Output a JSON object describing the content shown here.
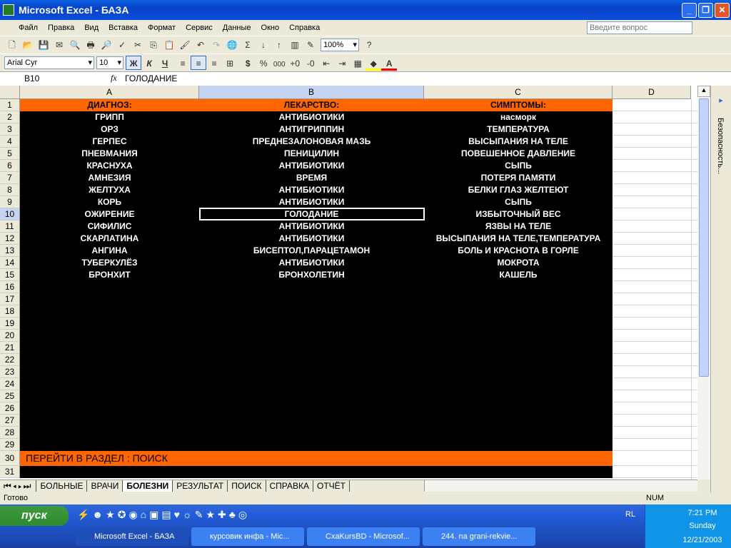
{
  "window": {
    "title": "Microsoft Excel - БАЗА"
  },
  "menu": [
    "Файл",
    "Правка",
    "Вид",
    "Вставка",
    "Формат",
    "Сервис",
    "Данные",
    "Окно",
    "Справка"
  ],
  "help_box": {
    "placeholder": "Введите вопрос"
  },
  "toolbar": {
    "zoom": "100%",
    "font": "Arial Cyr",
    "size": "10",
    "bold": "Ж",
    "italic": "К",
    "underline": "Ч",
    "currency": "$",
    "percent": "%",
    "thousands": "000",
    "sum": "Σ"
  },
  "formula_bar": {
    "name_box": "B10",
    "fx": "fx",
    "value": "ГОЛОДАНИЕ"
  },
  "columns": [
    "A",
    "B",
    "C",
    "D"
  ],
  "sheet": {
    "headers": [
      "ДИАГНОЗ:",
      "ЛЕКАРСТВО:",
      "СИМПТОМЫ:"
    ],
    "rows": [
      [
        "ГРИПП",
        "АНТИБИОТИКИ",
        "насморк"
      ],
      [
        "ОРЗ",
        "АНТИГРИППИН",
        "ТЕМПЕРАТУРА"
      ],
      [
        "ГЕРПЕС",
        "ПРЕДНЕЗАЛОНОВАЯ МАЗЬ",
        "ВЫСЫПАНИЯ НА ТЕЛЕ"
      ],
      [
        "ПНЕВМАНИЯ",
        "ПЕНИЦИЛИН",
        "ПОВЕШЕННОЕ ДАВЛЕНИЕ"
      ],
      [
        "КРАСНУХА",
        "АНТИБИОТИКИ",
        "СЫПЬ"
      ],
      [
        "АМНЕЗИЯ",
        "ВРЕМЯ",
        "ПОТЕРЯ ПАМЯТИ"
      ],
      [
        "ЖЕЛТУХА",
        "АНТИБИОТИКИ",
        "БЕЛКИ ГЛАЗ ЖЕЛТЕЮТ"
      ],
      [
        "КОРЬ",
        "АНТИБИОТИКИ",
        "СЫПЬ"
      ],
      [
        "ОЖИРЕНИЕ",
        "ГОЛОДАНИЕ",
        "ИЗБЫТОЧНЫЙ ВЕС"
      ],
      [
        "СИФИЛИС",
        "АНТИБИОТИКИ",
        "ЯЗВЫ НА ТЕЛЕ"
      ],
      [
        "СКАРЛАТИНА",
        "АНТИБИОТИКИ",
        "ВЫСЫПАНИЯ НА ТЕЛЕ,ТЕМПЕРАТУРА"
      ],
      [
        "АНГИНА",
        "БИСЕПТОЛ,ПАРАЦЕТАМОН",
        "БОЛЬ И КРАСНОТА В ГОРЛЕ"
      ],
      [
        "ТУБЕРКУЛЁЗ",
        "АНТИБИОТИКИ",
        "МОКРОТА"
      ],
      [
        "БРОНХИТ",
        "БРОНХОЛЕТИН",
        "КАШЕЛЬ"
      ]
    ],
    "link_row": "ПЕРЕЙТИ В РАЗДЕЛ : ПОИСК",
    "orange": "#ff6600"
  },
  "sheet_tabs": [
    "БОЛЬНЫЕ",
    "ВРАЧИ",
    "БОЛЕЗНИ",
    "РЕЗУЛЬТАТ",
    "ПОИСК",
    "СПРАВКА",
    "ОТЧЁТ"
  ],
  "active_tab": "БОЛЕЗНИ",
  "task_pane": {
    "label": "Безопасность..."
  },
  "status": {
    "left": "Готово",
    "num": "NUM"
  },
  "taskbar": {
    "start": "пуск",
    "lang": "RL",
    "tasks": [
      "Microsoft Excel - БАЗА",
      "курсовик инфа - Mic...",
      "CxaKursBD - Microsof...",
      "244. na grani-rekvie..."
    ],
    "time": "7:21 PM",
    "day": "Sunday",
    "date": "12/21/2003"
  }
}
